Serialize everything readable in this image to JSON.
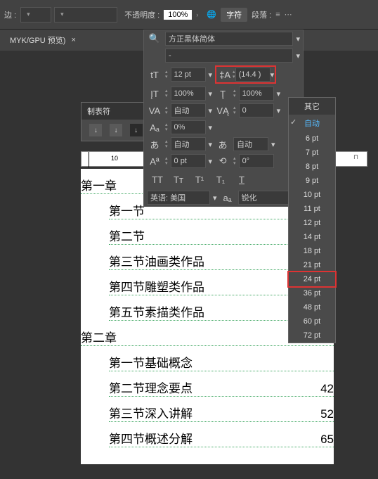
{
  "topbar": {
    "stroke_label": "边 :",
    "opacity_label": "不透明度 :",
    "opacity_value": "100%",
    "char_tab": "字符",
    "para_tab": "段落 :"
  },
  "tab": {
    "name": "MYK/GPU 预览)"
  },
  "tabs_panel": {
    "title": "制表符"
  },
  "ruler": {
    "mark": "10"
  },
  "char_panel": {
    "font_family": "方正黑体简体",
    "font_style": "-",
    "font_size": "12 pt",
    "leading": "(14.4 )",
    "vscale": "100%",
    "hscale": "100%",
    "kerning": "自动",
    "tracking": "0",
    "baseline_shift": "0%",
    "skew": "自动",
    "skew2": "自动",
    "weight": "0 pt",
    "rotate": "0°",
    "language": "英语: 美国",
    "aa": "锐化",
    "tt_allcaps": "TT",
    "tt_smallcaps": "Tᴛ",
    "tt_super": "T¹",
    "tt_sub": "T₁",
    "tt_underline": "T"
  },
  "dropdown": {
    "header": "其它",
    "auto": "自动",
    "items": [
      "6 pt",
      "7 pt",
      "8 pt",
      "9 pt",
      "10 pt",
      "11 pt",
      "12 pt",
      "14 pt",
      "18 pt",
      "21 pt",
      "24 pt",
      "36 pt",
      "48 pt",
      "60 pt",
      "72 pt"
    ],
    "highlighted": "24 pt"
  },
  "doc": {
    "chapters": [
      {
        "title": "第一章",
        "sections": [
          {
            "title": "第一节",
            "page": ""
          },
          {
            "title": "第二节",
            "page": ""
          },
          {
            "title": "第三节油画类作品",
            "page": ""
          },
          {
            "title": "第四节雕塑类作品",
            "page": ""
          },
          {
            "title": "第五节素描类作品",
            "page": ""
          }
        ]
      },
      {
        "title": "第二章",
        "sections": [
          {
            "title": "第一节基础概念",
            "page": ""
          },
          {
            "title": "第二节理念要点",
            "page": "42"
          },
          {
            "title": "第三节深入讲解",
            "page": "52"
          },
          {
            "title": "第四节概述分解",
            "page": "65"
          }
        ]
      }
    ]
  }
}
